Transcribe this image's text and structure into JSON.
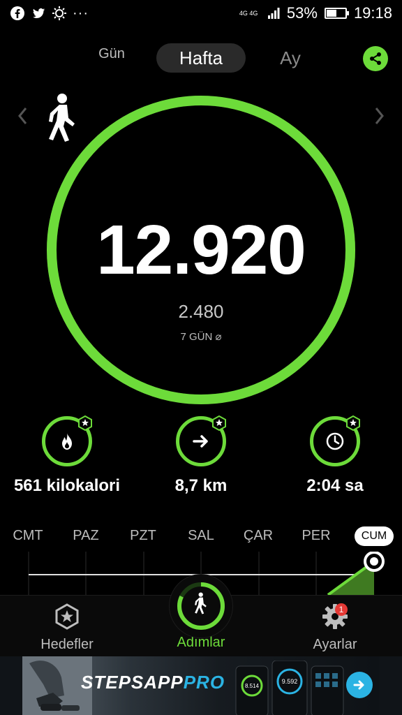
{
  "status_bar": {
    "network": "4G 4G",
    "battery_percent": "53%",
    "battery_level": 0.53,
    "time": "19:18",
    "left_icons": [
      "facebook-icon",
      "twitter-icon",
      "brightness-icon",
      "more-dots-icon"
    ]
  },
  "period_tabs": {
    "day": "Gün",
    "week": "Hafta",
    "month": "Ay",
    "selected": "Hafta"
  },
  "summary": {
    "steps": "12.920",
    "average": "2.480",
    "average_label": "7 GÜN ⌀",
    "goal_progress": 1.0
  },
  "stats": {
    "calories": "561 kilokalori",
    "distance": "8,7 km",
    "duration": "2:04 sa"
  },
  "week": {
    "days": [
      "CMT",
      "PAZ",
      "PZT",
      "SAL",
      "ÇAR",
      "PER",
      "CUM"
    ],
    "active_day": "CUM"
  },
  "bottom_nav": {
    "goals": "Hedefler",
    "steps": "Adımlar",
    "settings": "Ayarlar",
    "settings_badge": "1"
  },
  "ad": {
    "logo_part1": "STEPS",
    "logo_part2": "APP",
    "logo_part3": "PRO",
    "phone_values": [
      "8.514",
      "9.592"
    ]
  },
  "colors": {
    "accent": "#6ddb3a",
    "background": "#000000",
    "ad_accent": "#2bb3e3"
  }
}
